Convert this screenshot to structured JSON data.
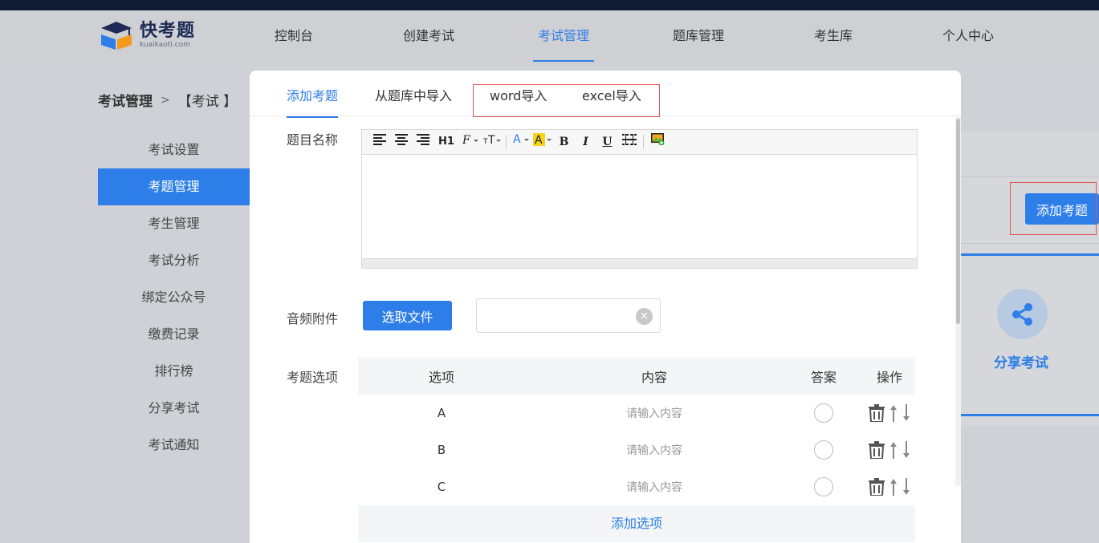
{
  "brand": {
    "name": "快考题",
    "domain": "kuaikaoti.com"
  },
  "nav": [
    "控制台",
    "创建考试",
    "考试管理",
    "题库管理",
    "考生库",
    "个人中心"
  ],
  "nav_active": "考试管理",
  "breadcrumb": {
    "section": "考试管理",
    "separator": ">",
    "current": "【考试 】"
  },
  "sidebar": [
    "考试设置",
    "考题管理",
    "考生管理",
    "考试分析",
    "绑定公众号",
    "缴费记录",
    "排行榜",
    "分享考试",
    "考试通知"
  ],
  "sidebar_active": "考题管理",
  "right_panel": {
    "add_button": "添加考题",
    "share_label": "分享考试"
  },
  "modal": {
    "tabs": [
      "添加考题",
      "从题库中导入",
      "word导入",
      "excel导入"
    ],
    "active_tab": "添加考题",
    "question_name_label": "题目名称",
    "audio_label": "音频附件",
    "pick_file_button": "选取文件",
    "file_value": "",
    "options_label": "考题选项",
    "table_headers": [
      "选项",
      "内容",
      "答案",
      "操作"
    ],
    "rows": [
      {
        "option": "A",
        "placeholder": "请输入内容"
      },
      {
        "option": "B",
        "placeholder": "请输入内容"
      },
      {
        "option": "C",
        "placeholder": "请输入内容"
      }
    ],
    "add_option": "添加选项",
    "toolbar": [
      "align-left",
      "align-center",
      "align-right",
      "H1",
      "font-family",
      "font-size",
      "font-color",
      "highlight",
      "B",
      "I",
      "U",
      "table",
      "image"
    ]
  },
  "colors": {
    "accent": "#2d7ee8",
    "highlight_box": "#e05555",
    "header_dark": "#0f1a33"
  }
}
